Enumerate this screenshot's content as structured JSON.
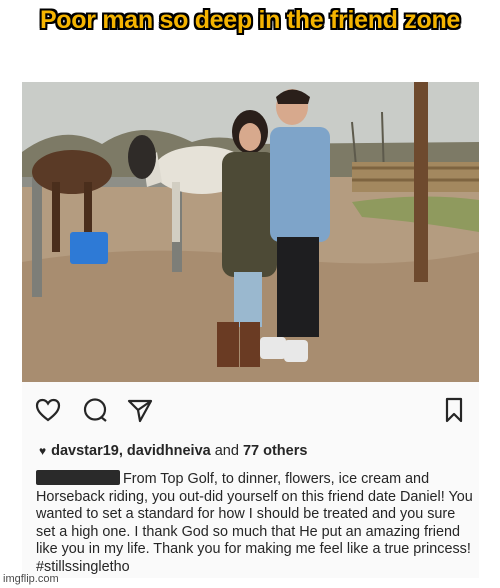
{
  "meme": {
    "title": "Poor man so deep in the friend zone"
  },
  "post": {
    "actions": {
      "like_icon": "heart-outline-icon",
      "comment_icon": "comment-bubble-icon",
      "share_icon": "send-paper-plane-icon",
      "save_icon": "bookmark-icon"
    },
    "likes": {
      "heart_glyph": "♥",
      "names": "davstar19, davidhneiva",
      "and_text": "and",
      "others": "77 others"
    },
    "caption": {
      "username_redacted": true,
      "text": "From Top Golf, to dinner, flowers, ice cream and Horseback riding, you out-did yourself on this friend date Daniel! You wanted to set a standard for how I should be treated and you sure set a high one. I thank God so much that He put an amazing friend like you in my life. Thank you for making me feel like a true princess! #stillssingletho"
    }
  },
  "watermark": {
    "text": "imgflip.com"
  }
}
